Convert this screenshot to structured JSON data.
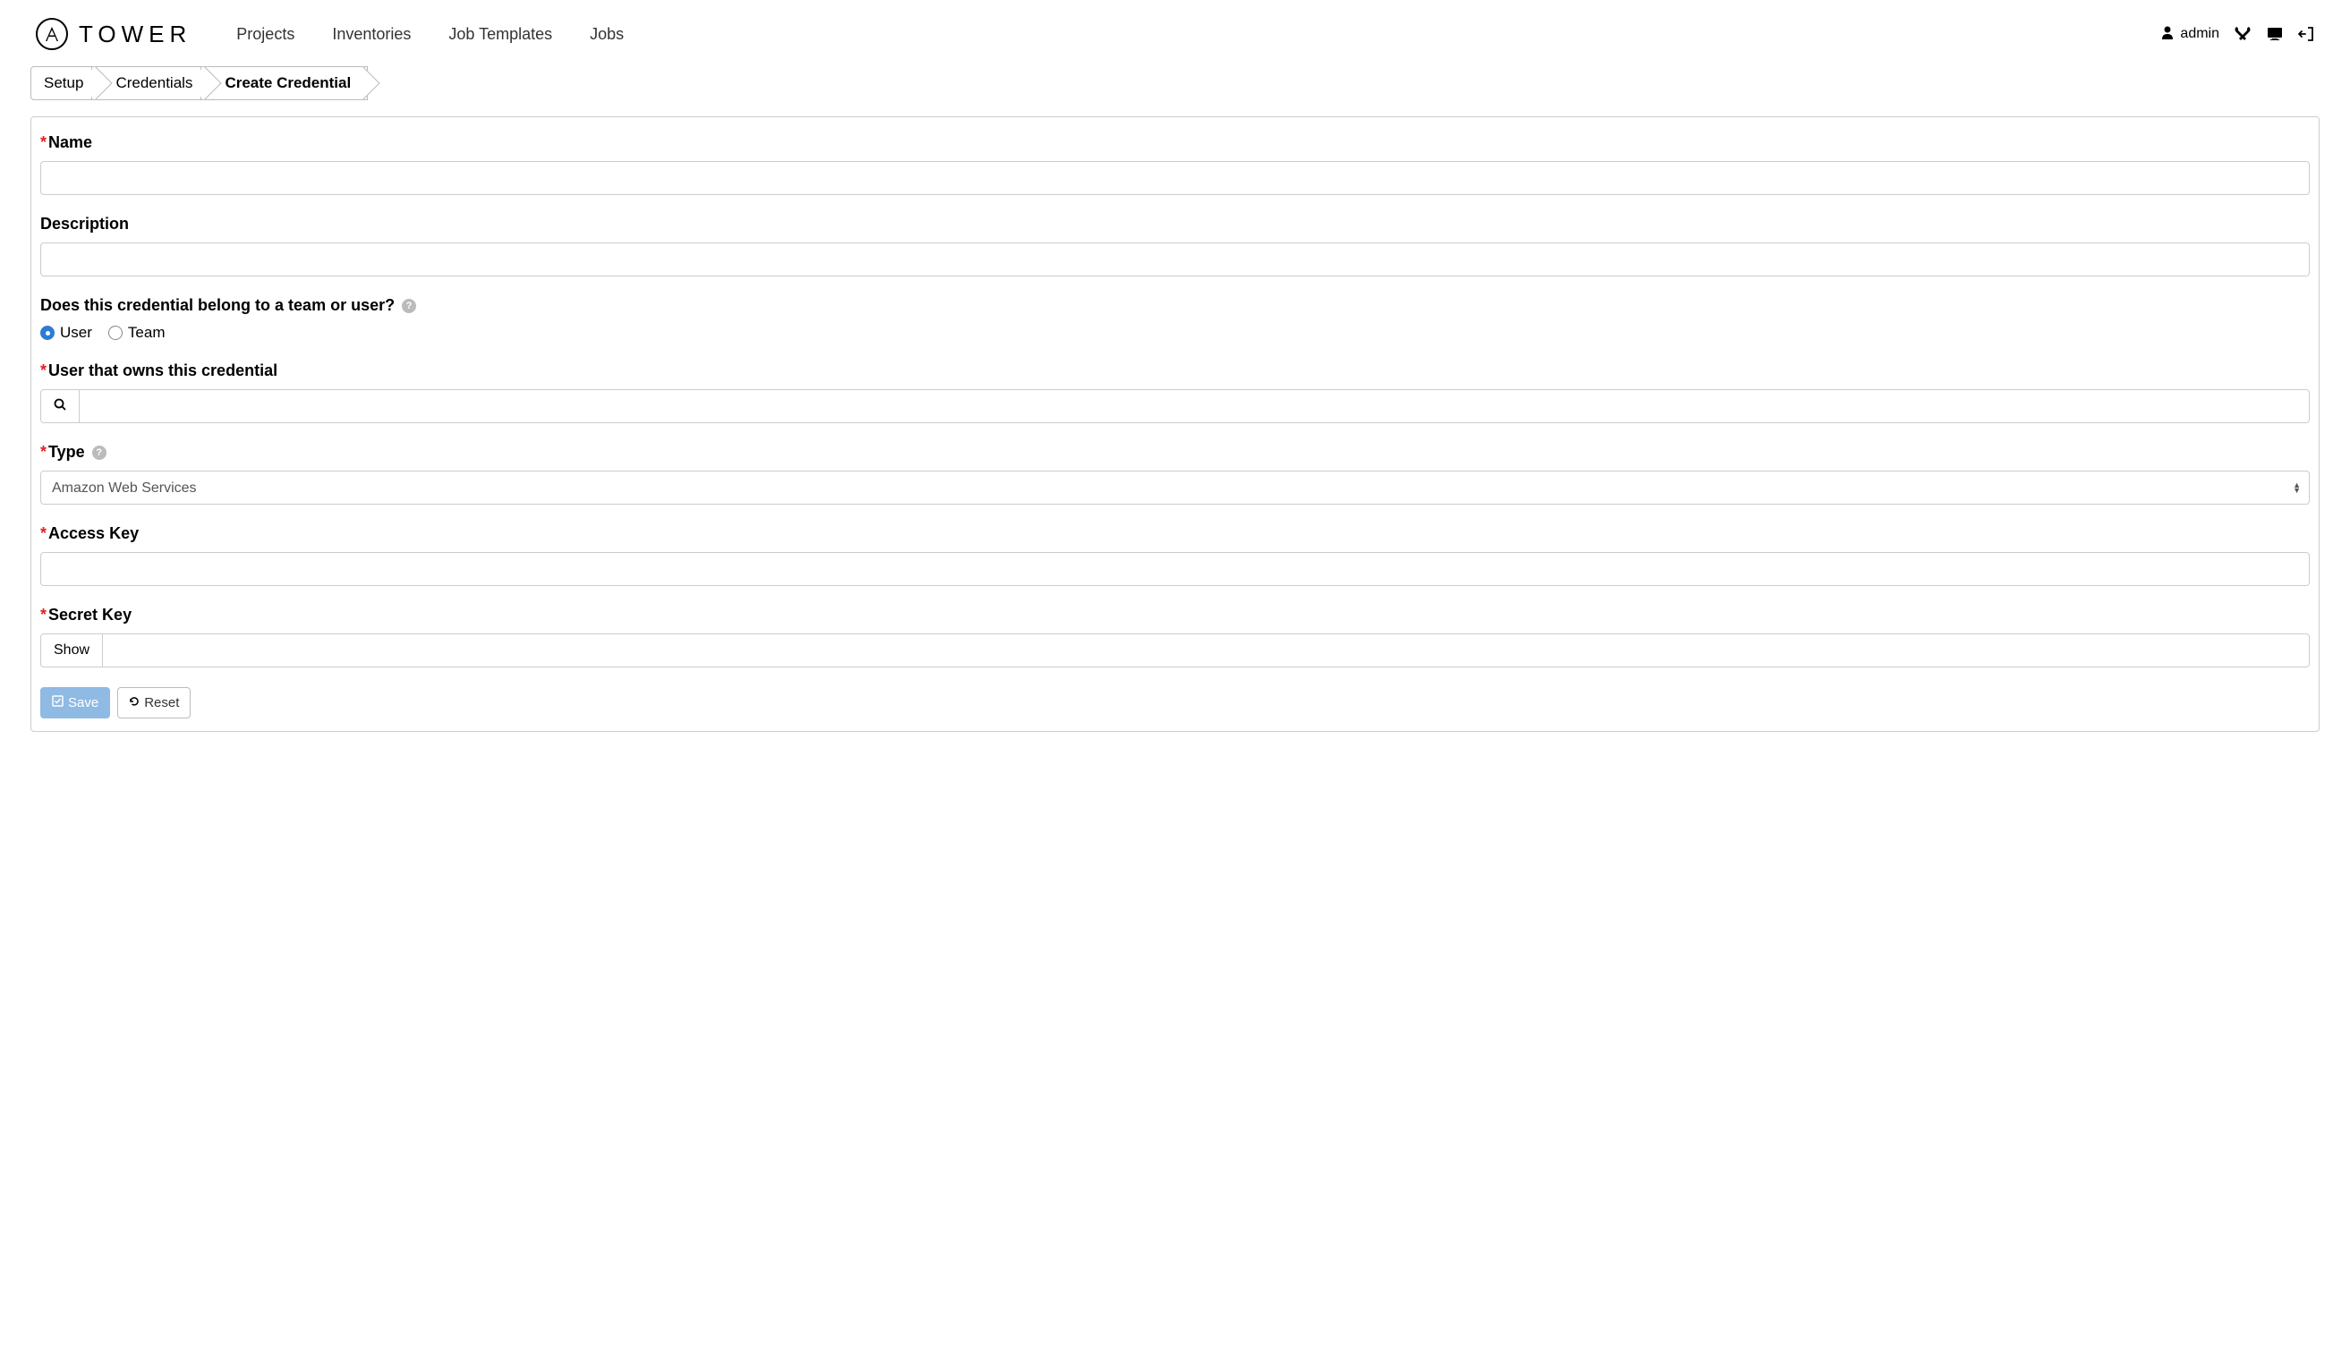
{
  "header": {
    "logo_text": "TOWER",
    "nav": {
      "projects": "Projects",
      "inventories": "Inventories",
      "job_templates": "Job Templates",
      "jobs": "Jobs"
    },
    "user_label": "admin"
  },
  "breadcrumb": {
    "setup": "Setup",
    "credentials": "Credentials",
    "create_credential": "Create Credential"
  },
  "form": {
    "name_label": "Name",
    "name_value": "",
    "description_label": "Description",
    "description_value": "",
    "owner_question": "Does this credential belong to a team or user?",
    "owner_options": {
      "user": "User",
      "team": "Team"
    },
    "owner_selected": "user",
    "user_owns_label": "User that owns this credential",
    "user_owns_value": "",
    "type_label": "Type",
    "type_value": "Amazon Web Services",
    "access_key_label": "Access Key",
    "access_key_value": "",
    "secret_key_label": "Secret Key",
    "secret_key_value": "",
    "show_button": "Show",
    "save_button": "Save",
    "reset_button": "Reset"
  }
}
